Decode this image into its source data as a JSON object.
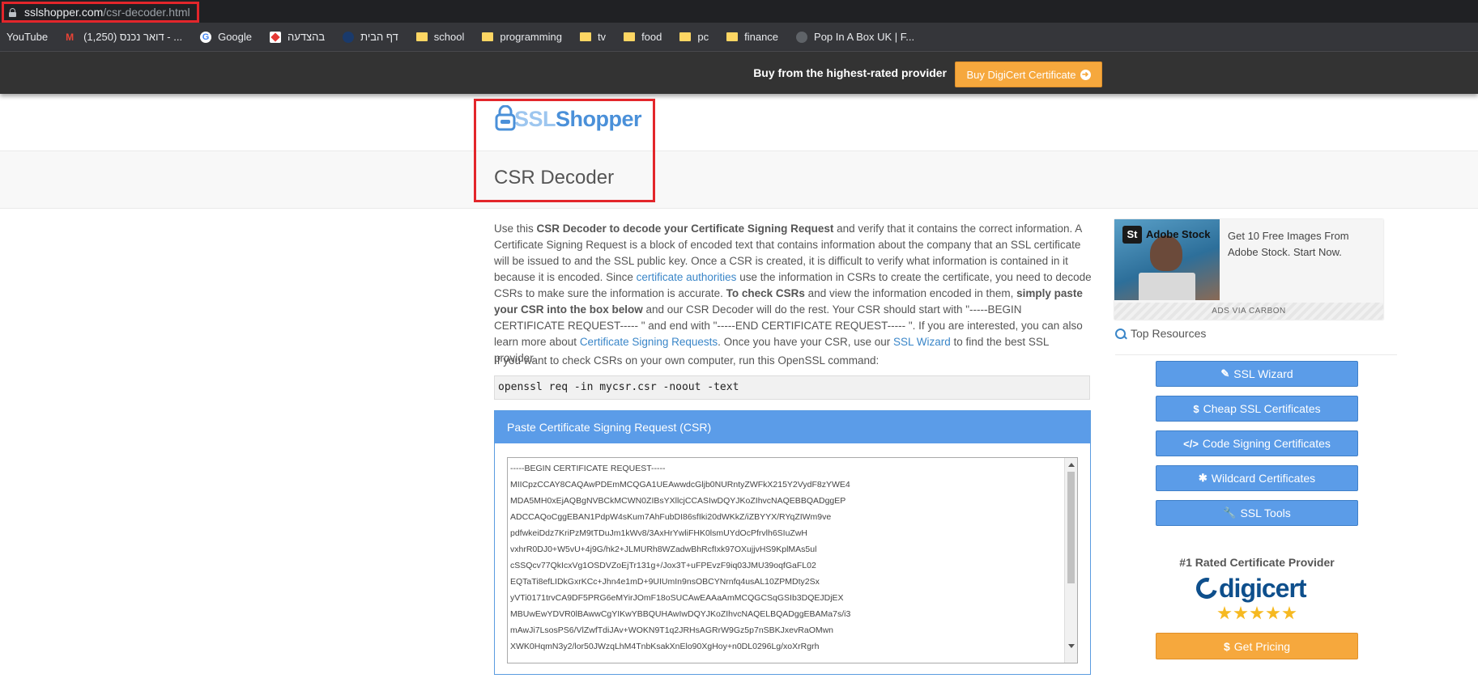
{
  "browser": {
    "url_domain": "sslshopper.com",
    "url_path": "/csr-decoder.html",
    "bookmarks": [
      {
        "label": "YouTube",
        "icon": "none"
      },
      {
        "label": "(1,250) דואר נכנס - ...",
        "icon": "gmail-icon"
      },
      {
        "label": "Google",
        "icon": "google-icon"
      },
      {
        "label": "בהצדעה",
        "icon": "site-icon"
      },
      {
        "label": "דף הבית",
        "icon": "site-icon"
      },
      {
        "label": "school",
        "icon": "folder-icon"
      },
      {
        "label": "programming",
        "icon": "folder-icon"
      },
      {
        "label": "tv",
        "icon": "folder-icon"
      },
      {
        "label": "food",
        "icon": "folder-icon"
      },
      {
        "label": "pc",
        "icon": "folder-icon"
      },
      {
        "label": "finance",
        "icon": "folder-icon"
      },
      {
        "label": "Pop In A Box UK | F...",
        "icon": "site-icon"
      }
    ]
  },
  "promo": {
    "text": "Buy from the highest-rated provider",
    "button_label": "Buy DigiCert Certificate",
    "button_icon": "arrow-right-icon"
  },
  "logo": {
    "ssl": "SSL",
    "shopper": "Shopper"
  },
  "page_title": "CSR Decoder",
  "intro": {
    "p1": "Use this ",
    "b1": "CSR Decoder to decode your Certificate Signing Request",
    "p2": " and verify that it contains the correct information. A Certificate Signing Request is a block of encoded text that contains information about the company that an SSL certificate will be issued to and the SSL public key. Once a CSR is created, it is difficult to verify what information is contained in it because it is encoded. Since ",
    "link1": "certificate authorities",
    "p3": " use the information in CSRs to create the certificate, you need to decode CSRs to make sure the information is accurate. ",
    "b2": "To check CSRs",
    "p4": " and view the information encoded in them, ",
    "b3": "simply paste your CSR into the box below",
    "p5": " and our CSR Decoder will do the rest. Your CSR should start with \"-----BEGIN CERTIFICATE REQUEST----- \" and end with \"-----END CERTIFICATE REQUEST----- \". If you are interested, you can also learn more about ",
    "link2": "Certificate Signing Requests",
    "p6": ". Once you have your CSR, use our ",
    "link3": "SSL Wizard",
    "p7": " to find the best SSL provider."
  },
  "openssl": {
    "label": "If you want to check CSRs on your own computer, run this OpenSSL command:",
    "command": "openssl req -in mycsr.csr -noout -text"
  },
  "csr_panel": {
    "heading": "Paste Certificate Signing Request (CSR)",
    "lines": [
      "-----BEGIN CERTIFICATE REQUEST-----",
      "MIICpzCCAY8CAQAwPDEmMCQGA1UEAwwdcGljb0NURntyZWFkX215Y2VydF8zYWE4",
      "MDA5MH0xEjAQBgNVBCkMCWN0ZIBsYXllcjCCASIwDQYJKoZIhvcNAQEBBQADggEP",
      "ADCCAQoCggEBAN1PdpW4sKum7AhFubDI86sfIki20dWKkZ/iZBYYX/RYqZIWm9ve",
      "pdfwkeiDdz7KriPzM9tTDuJm1kWv8/3AxHrYwliFHK0lsmUYdOcPfrvlh6SIuZwH",
      "vxhrR0DJ0+W5vU+4j9G/hk2+JLMURh8WZadwBhRcfIxk97OXujjvHS9KplMAs5ul",
      "cSSQcv77QkIcxVg1OSDVZoEjTr131g+/Jox3T+uFPEvzF9iq03JMU39oqfGaFL02",
      "EQTaTi8efLIDkGxrKCc+Jhn4e1mD+9UIUmIn9nsOBCYNrnfq4usAL10ZPMDty2Sx",
      "yVTi0171trvCA9DF5PRG6eMYirJOmF18oSUCAwEAAaAmMCQGCSqGSIb3DQEJDjEX",
      "MBUwEwYDVR0lBAwwCgYIKwYBBQUHAwIwDQYJKoZIhvcNAQELBQADggEBAMa7s/i3",
      "mAwJi7LsosPS6/VlZwfTdiJAv+WOKN9T1q2JRHsAGRrW9Gz5p7nSBKJxevRaOMwn",
      "XWK0HqmN3y2/lor50JWzqLhM4TnbKsakXnElo90XgHoy+n0DL0296Lg/xoXrRgrh"
    ]
  },
  "ad": {
    "brand": "Adobe Stock",
    "copy": "Get 10 Free Images From Adobe Stock. Start Now.",
    "via": "ADS VIA CARBON"
  },
  "sidebar": {
    "heading": "Top Resources",
    "buttons": [
      {
        "label": "SSL Wizard",
        "icon": "✎"
      },
      {
        "label": "Cheap SSL Certificates",
        "icon": "$"
      },
      {
        "label": "Code Signing Certificates",
        "icon": "</>"
      },
      {
        "label": "Wildcard Certificates",
        "icon": "✱"
      },
      {
        "label": "SSL Tools",
        "icon": "🔧"
      }
    ],
    "rated_title": "#1 Rated Certificate Provider",
    "provider": "digicert",
    "rating": 5,
    "get_pricing": "Get Pricing",
    "get_pricing_icon": "$"
  },
  "colors": {
    "accent": "#5b9ce8",
    "orange": "#f6a83d",
    "highlight": "#e3262b"
  }
}
